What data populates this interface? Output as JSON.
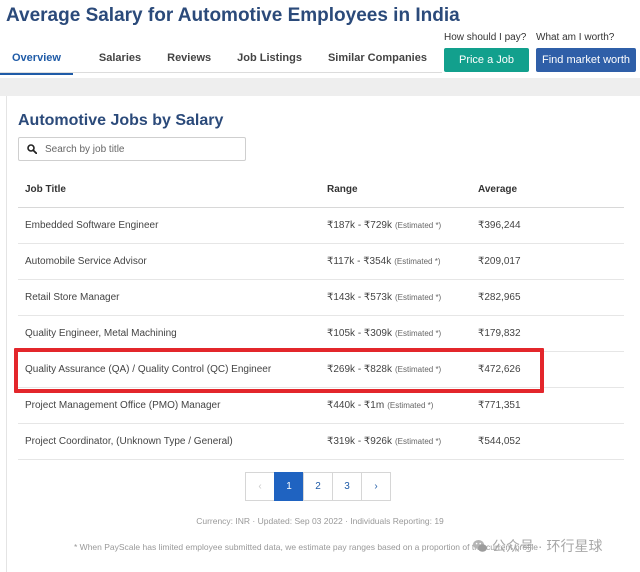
{
  "page": {
    "title": "Average Salary for Automotive Employees in India"
  },
  "tabs": [
    {
      "label": "Overview"
    },
    {
      "label": "Salaries"
    },
    {
      "label": "Reviews"
    },
    {
      "label": "Job Listings"
    },
    {
      "label": "Similar Companies"
    }
  ],
  "cta": {
    "pay_caption": "How should I pay?",
    "pay_button": "Price a Job",
    "worth_caption": "What am I worth?",
    "worth_button": "Find market worth"
  },
  "section": {
    "title": "Automotive Jobs by Salary",
    "search_placeholder": "Search by job title"
  },
  "table": {
    "headers": {
      "job_title": "Job Title",
      "range": "Range",
      "average": "Average"
    },
    "estimated_label": "(Estimated *)",
    "rows": [
      {
        "job_title": "Embedded Software Engineer",
        "range": "₹187k - ₹729k",
        "average": "₹396,244"
      },
      {
        "job_title": "Automobile Service Advisor",
        "range": "₹117k - ₹354k",
        "average": "₹209,017"
      },
      {
        "job_title": "Retail Store Manager",
        "range": "₹143k - ₹573k",
        "average": "₹282,965"
      },
      {
        "job_title": "Quality Engineer, Metal Machining",
        "range": "₹105k - ₹309k",
        "average": "₹179,832"
      },
      {
        "job_title": "Quality Assurance (QA) / Quality Control (QC) Engineer",
        "range": "₹269k - ₹828k",
        "average": "₹472,626"
      },
      {
        "job_title": "Project Management Office (PMO) Manager",
        "range": "₹440k - ₹1m",
        "average": "₹771,351"
      },
      {
        "job_title": "Project Coordinator, (Unknown Type / General)",
        "range": "₹319k - ₹926k",
        "average": "₹544,052"
      }
    ]
  },
  "pagination": {
    "prev": "‹",
    "pages": [
      "1",
      "2",
      "3"
    ],
    "next": "›",
    "current_page": "1"
  },
  "footer": {
    "meta": "Currency: INR · Updated: Sep 03 2022 · Individuals Reporting: 19",
    "note": "* When PayScale has limited employee submitted data, we estimate pay ranges based on a proportion of the current profile"
  },
  "watermark": {
    "text": "公众号 · 环行星球",
    "icon": "wechat-icon"
  },
  "colors": {
    "brand_navy": "#2b4a7a",
    "accent_blue": "#1f5ba7",
    "teal_button": "#12a08d",
    "blue_button": "#2f5fa8",
    "highlight_red": "#e3262b"
  }
}
